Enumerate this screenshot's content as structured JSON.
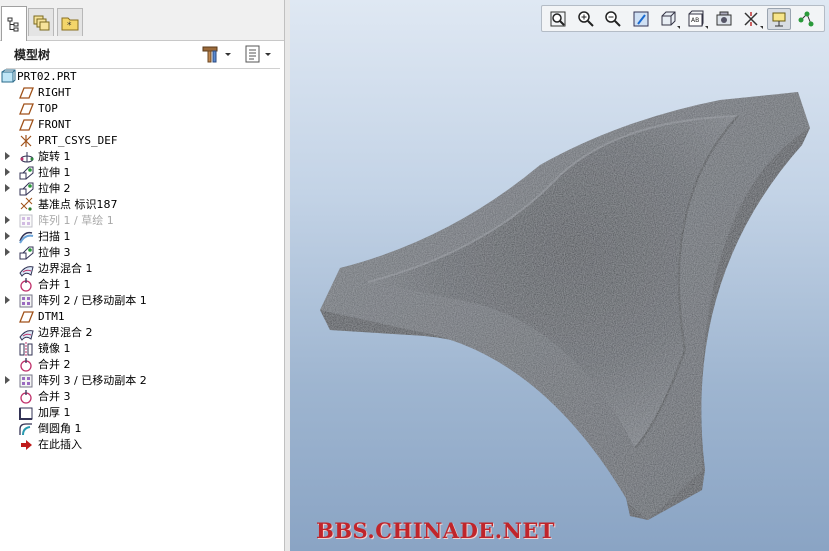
{
  "panel": {
    "title": "模型树",
    "tabs": [
      "model-tree",
      "layers",
      "favorites"
    ]
  },
  "tree": {
    "items": [
      {
        "label": "PRT02.PRT",
        "icon": "part-icon",
        "expandable": false,
        "dim": false
      },
      {
        "label": "RIGHT",
        "icon": "datum-plane-icon",
        "expandable": false,
        "dim": false
      },
      {
        "label": "TOP",
        "icon": "datum-plane-icon",
        "expandable": false,
        "dim": false
      },
      {
        "label": "FRONT",
        "icon": "datum-plane-icon",
        "expandable": false,
        "dim": false
      },
      {
        "label": "PRT_CSYS_DEF",
        "icon": "csys-icon",
        "expandable": false,
        "dim": false
      },
      {
        "label": "旋转 1",
        "icon": "revolve-icon",
        "expandable": true,
        "dim": false
      },
      {
        "label": "拉伸 1",
        "icon": "extrude-icon",
        "expandable": true,
        "dim": false
      },
      {
        "label": "拉伸 2",
        "icon": "extrude-icon",
        "expandable": true,
        "dim": false
      },
      {
        "label": "基准点 标识187",
        "icon": "datum-point-icon",
        "expandable": false,
        "dim": false
      },
      {
        "label": "阵列 1 / 草绘 1",
        "icon": "pattern-icon",
        "expandable": true,
        "dim": true
      },
      {
        "label": "扫描 1",
        "icon": "sweep-icon",
        "expandable": true,
        "dim": false
      },
      {
        "label": "拉伸 3",
        "icon": "extrude-icon",
        "expandable": true,
        "dim": false
      },
      {
        "label": "边界混合 1",
        "icon": "boundary-blend-icon",
        "expandable": false,
        "dim": false
      },
      {
        "label": "合并 1",
        "icon": "merge-icon",
        "expandable": false,
        "dim": false
      },
      {
        "label": "阵列 2 / 已移动副本 1",
        "icon": "pattern-icon",
        "expandable": true,
        "dim": false
      },
      {
        "label": "DTM1",
        "icon": "datum-plane-icon",
        "expandable": false,
        "dim": false
      },
      {
        "label": "边界混合 2",
        "icon": "boundary-blend-icon",
        "expandable": false,
        "dim": false
      },
      {
        "label": "镜像 1",
        "icon": "mirror-icon",
        "expandable": false,
        "dim": false
      },
      {
        "label": "合并 2",
        "icon": "merge-icon",
        "expandable": false,
        "dim": false
      },
      {
        "label": "阵列 3 / 已移动副本 2",
        "icon": "pattern-icon",
        "expandable": true,
        "dim": false
      },
      {
        "label": "合并 3",
        "icon": "merge-icon",
        "expandable": false,
        "dim": false
      },
      {
        "label": "加厚 1",
        "icon": "thicken-icon",
        "expandable": false,
        "dim": false
      },
      {
        "label": "倒圆角 1",
        "icon": "round-icon",
        "expandable": false,
        "dim": false
      },
      {
        "label": "在此插入",
        "icon": "insert-here-arrow-icon",
        "expandable": false,
        "dim": false
      }
    ]
  },
  "toolbar": {
    "buttons": [
      {
        "name": "refit-icon"
      },
      {
        "name": "zoom-in-icon"
      },
      {
        "name": "zoom-out-icon"
      },
      {
        "name": "repaint-icon"
      },
      {
        "name": "display-style-icon"
      },
      {
        "name": "saved-orientations-icon"
      },
      {
        "name": "view-manager-icon"
      },
      {
        "name": "datum-display-icon"
      },
      {
        "name": "annotation-display-icon"
      },
      {
        "name": "spin-center-icon"
      }
    ]
  },
  "watermark": "BBS.CHINADE.NET",
  "colors": {
    "viewport_top": "#dfe8f3",
    "viewport_bottom": "#8aa4c4",
    "watermark": "#c0252b",
    "part_surface": "#4a4e54"
  }
}
